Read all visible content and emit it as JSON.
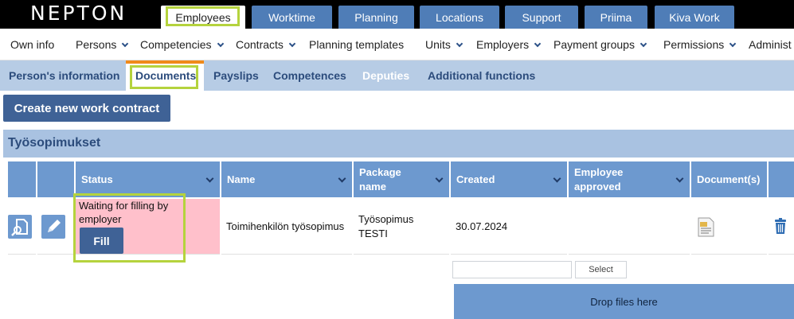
{
  "brand": "NEPTON",
  "top_tabs": [
    {
      "label": "Employees",
      "active": true
    },
    {
      "label": "Worktime",
      "active": false
    },
    {
      "label": "Planning",
      "active": false
    },
    {
      "label": "Locations",
      "active": false
    },
    {
      "label": "Support",
      "active": false
    },
    {
      "label": "Priima",
      "active": false
    },
    {
      "label": "Kiva Work",
      "active": false
    }
  ],
  "menu": [
    {
      "label": "Own info",
      "dropdown": false
    },
    {
      "label": "Persons",
      "dropdown": true
    },
    {
      "label": "Competencies",
      "dropdown": true
    },
    {
      "label": "Contracts",
      "dropdown": true
    },
    {
      "label": "Planning templates",
      "dropdown": false
    },
    {
      "label": "Units",
      "dropdown": true
    },
    {
      "label": "Employers",
      "dropdown": true
    },
    {
      "label": "Payment groups",
      "dropdown": true
    },
    {
      "label": "Permissions",
      "dropdown": true
    },
    {
      "label": "Administ",
      "dropdown": false
    }
  ],
  "sub_tabs": [
    {
      "label": "Person's information",
      "active": false
    },
    {
      "label": "Documents",
      "active": true
    },
    {
      "label": "Payslips",
      "active": false
    },
    {
      "label": "Competences",
      "active": false
    },
    {
      "label": "Deputies",
      "active": false
    },
    {
      "label": "Additional functions",
      "active": false
    }
  ],
  "create_button": "Create new work contract",
  "section_title": "Työsopimukset",
  "table": {
    "headers": [
      "",
      "",
      "Status",
      "Name",
      "Package name",
      "Created",
      "Employee approved",
      "Document(s)",
      ""
    ],
    "rows": [
      {
        "status": "Waiting for filling by employer",
        "fill_button": "Fill",
        "name": "Toimihenkilön työsopimus",
        "package_name": "Työsopimus TESTI",
        "created": "30.07.2024",
        "employee_approved": ""
      }
    ]
  },
  "upload": {
    "input_value": "",
    "select_button": "Select",
    "dropzone": "Drop files here"
  },
  "colors": {
    "accent": "#3f6296",
    "tab_blue": "#4f7db7",
    "header_blue": "#6d99cf",
    "highlight": "#b5d33d",
    "status_pink": "#ffc0cb",
    "active_tab_marker": "#f08a1a"
  },
  "icons": {
    "row_view": "document-search-icon",
    "row_edit": "pencil-icon",
    "document": "text-document-icon",
    "delete": "trash-icon"
  }
}
